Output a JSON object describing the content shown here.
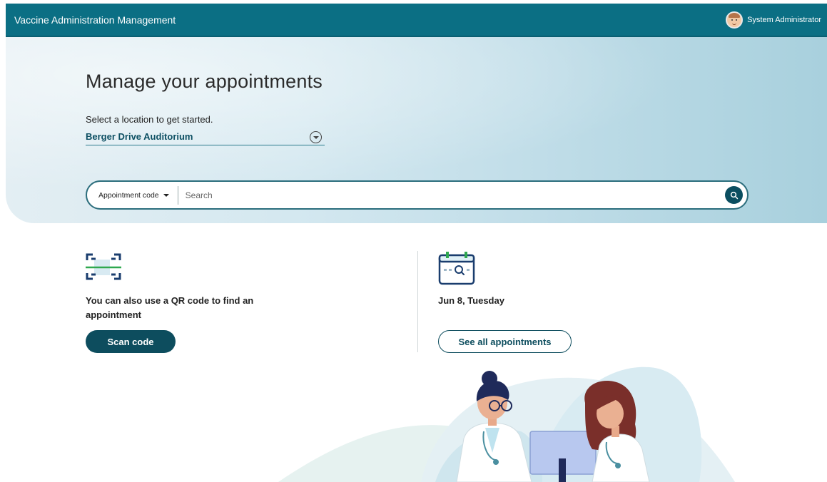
{
  "header": {
    "app_title": "Vaccine Administration Management",
    "user_name": "System Administrator"
  },
  "hero": {
    "title": "Manage your appointments",
    "location_label": "Select a location to get started.",
    "location_value": "Berger Drive Auditorium"
  },
  "search": {
    "type_label": "Appointment code",
    "placeholder": "Search"
  },
  "qr": {
    "text": "You can also use a QR code to find an appointment",
    "button_label": "Scan code"
  },
  "calendar": {
    "date": "Jun 8, Tuesday",
    "button_label": "See all appointments"
  },
  "colors": {
    "primary": "#0b6f84",
    "dark_teal": "#0d4d5e",
    "accent_green": "#2fa84f"
  }
}
